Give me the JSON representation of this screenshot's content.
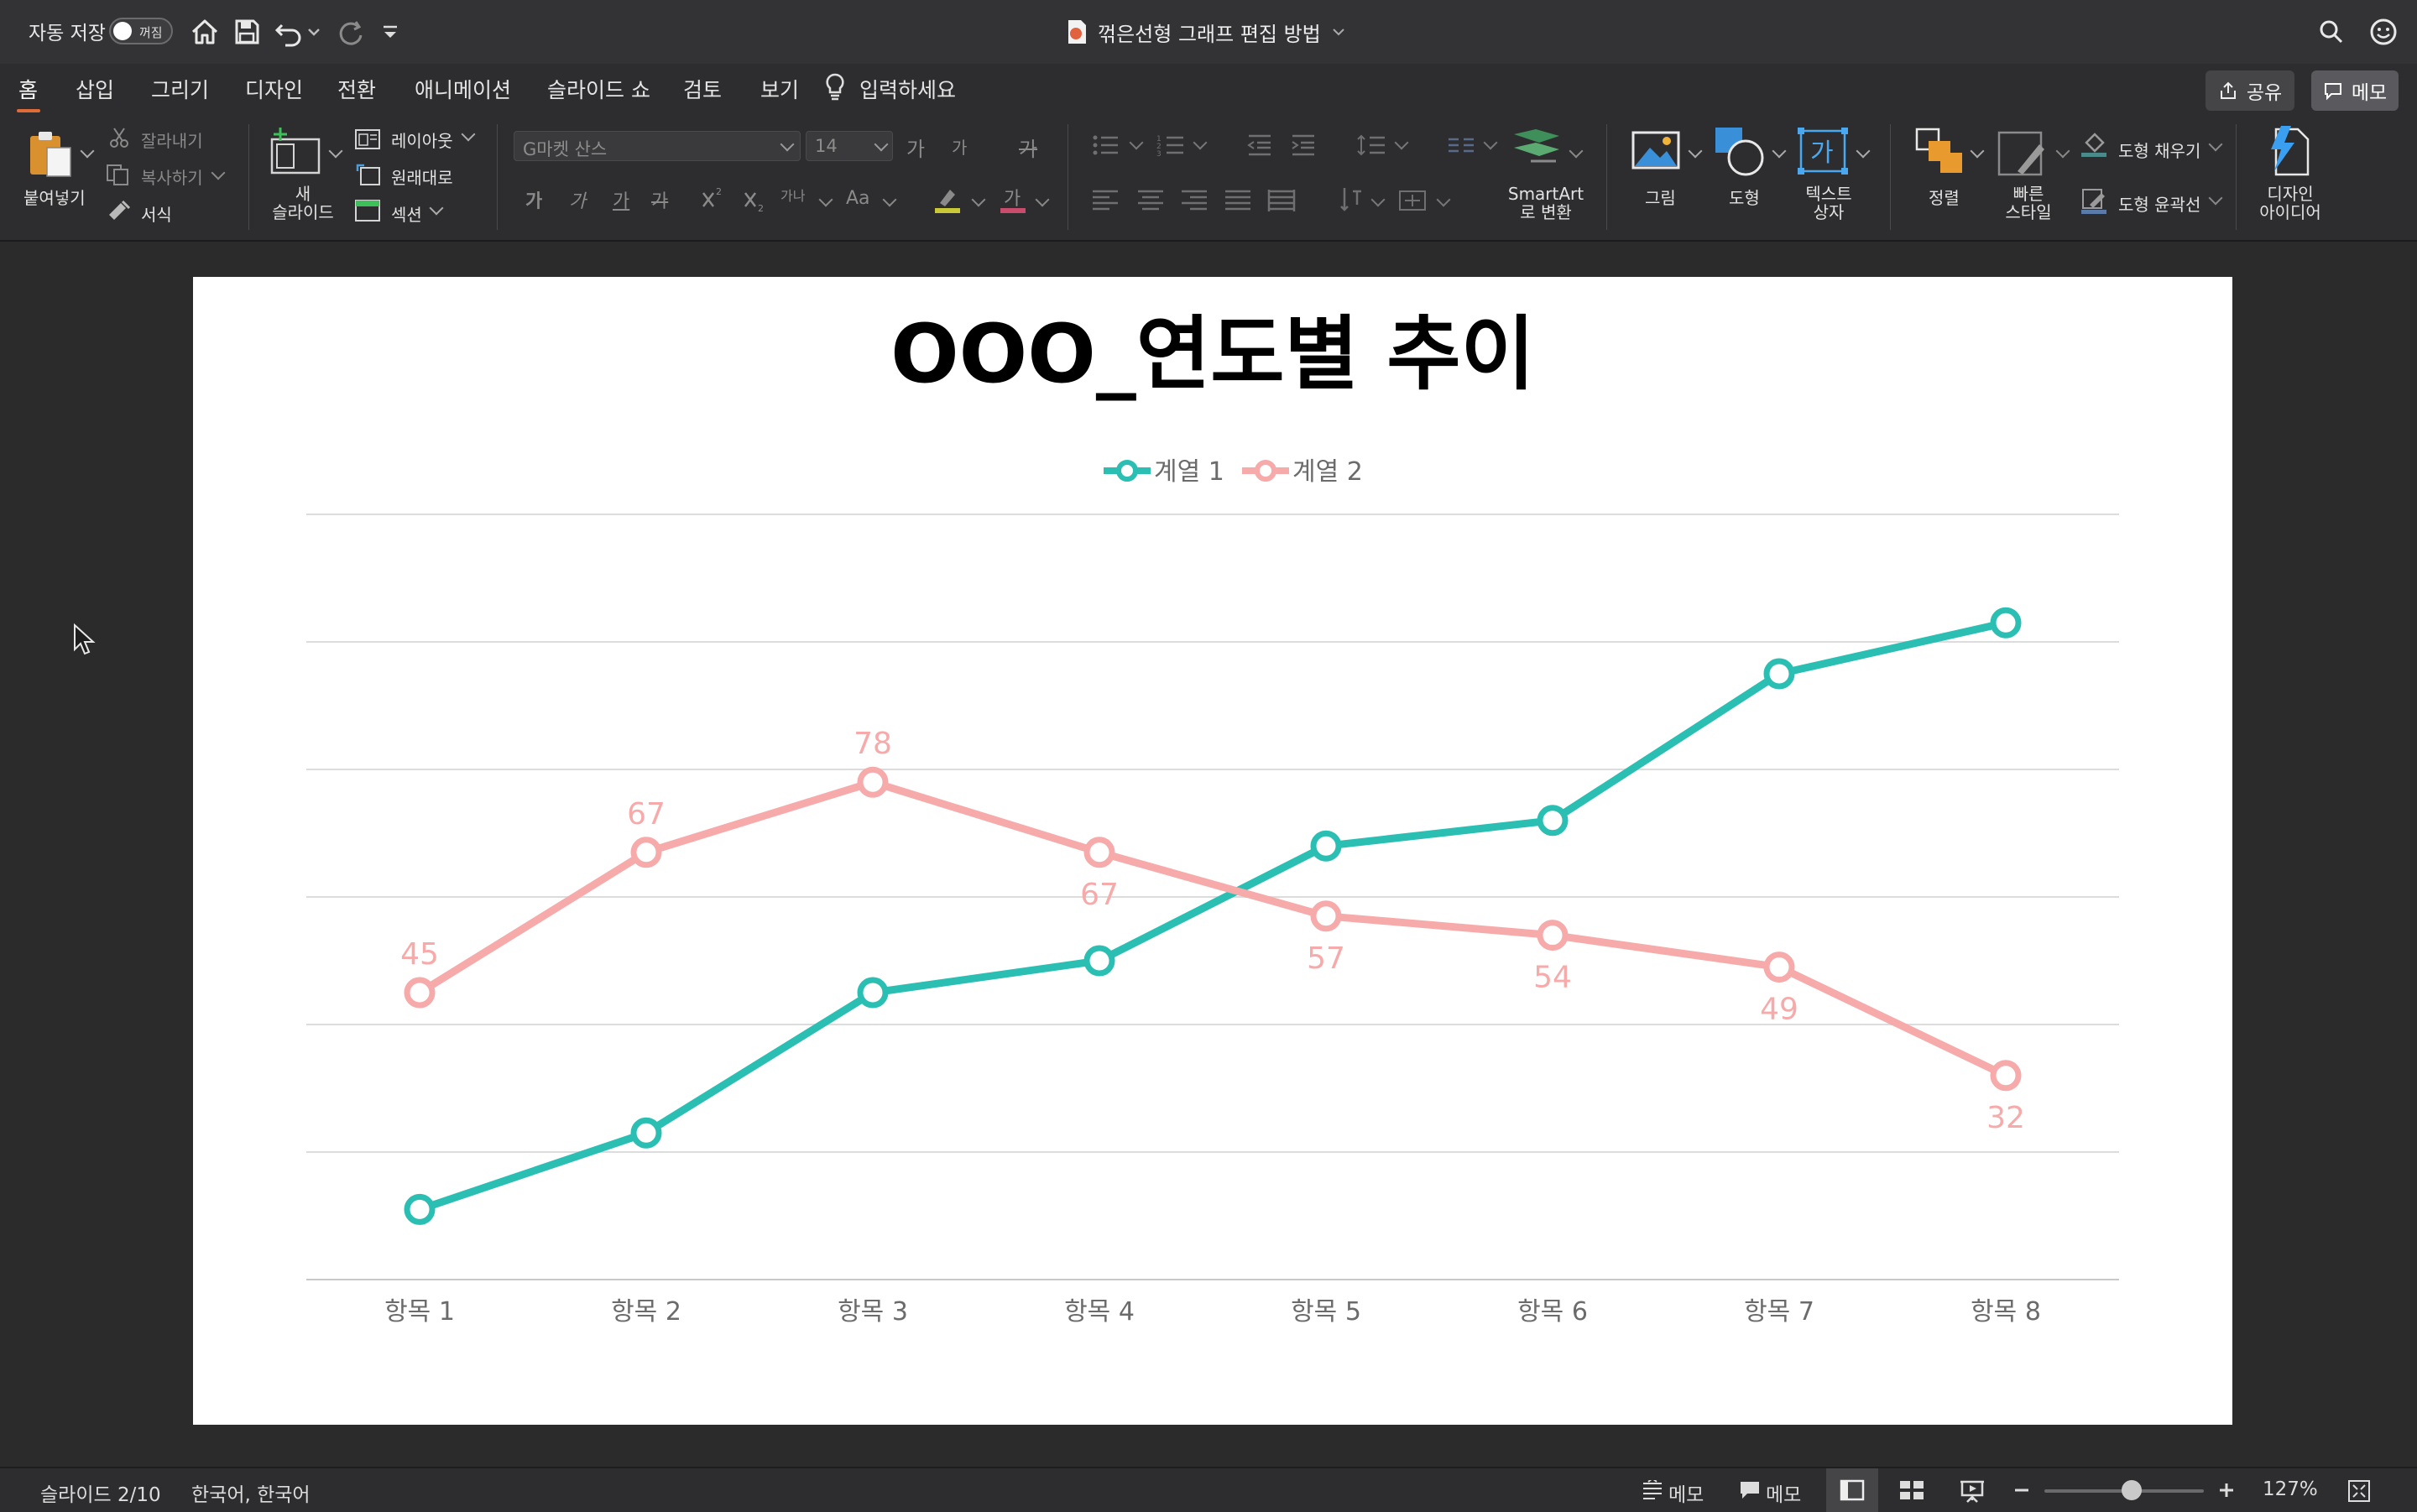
{
  "titlebar": {
    "autosave_label": "자동 저장",
    "autosave_state": "꺼짐",
    "document_title": "꺾은선형 그래프 편집 방법"
  },
  "menu": {
    "tabs": [
      "홈",
      "삽입",
      "그리기",
      "디자인",
      "전환",
      "애니메이션",
      "슬라이드 쇼",
      "검토",
      "보기"
    ],
    "tell_me": "입력하세요",
    "share": "공유",
    "memo": "메모"
  },
  "ribbon": {
    "paste": "붙여넣기",
    "cut": "잘라내기",
    "copy": "복사하기",
    "format_painter": "서식",
    "new_slide_line1": "새",
    "new_slide_line2": "슬라이드",
    "layout": "레이아웃",
    "reset": "원래대로",
    "section": "섹션",
    "font_name": "G마켓 산스",
    "font_size": "14",
    "font_grow": "가",
    "font_shrink": "가",
    "clear_format": "가",
    "bold": "가",
    "italic": "가",
    "underline": "가",
    "strike": "가",
    "spacing": "가나",
    "case": "Aa",
    "font_color": "가",
    "smartart_line1": "SmartArt",
    "smartart_line2": "로 변환",
    "picture": "그림",
    "shape": "도형",
    "textbox_line1": "텍스트",
    "textbox_line2": "상자",
    "textbox_glyph": "가",
    "arrange": "정렬",
    "quick_style_line1": "빠른",
    "quick_style_line2": "스타일",
    "shape_fill": "도형 채우기",
    "shape_outline": "도형 윤곽선",
    "designer_line1": "디자인",
    "designer_line2": "아이디어"
  },
  "status": {
    "slide_info": "슬라이드 2/10",
    "language": "한국어, 한국어",
    "notes": "메모",
    "comments": "메모",
    "zoom": "127%"
  },
  "colors": {
    "series1": "#2bbfb3",
    "series2": "#f7aaaa",
    "accent": "#e06a38"
  },
  "chart_data": {
    "type": "line",
    "title": "OOO_연도별 추이",
    "categories": [
      "항목 1",
      "항목 2",
      "항목 3",
      "항목 4",
      "항목 5",
      "항목 6",
      "항목 7",
      "항목 8"
    ],
    "series": [
      {
        "name": "계열 1",
        "values": [
          11,
          23,
          45,
          50,
          68,
          72,
          95,
          103
        ],
        "data_labels": false
      },
      {
        "name": "계열 2",
        "values": [
          45,
          67,
          78,
          67,
          57,
          54,
          49,
          32
        ],
        "data_labels": true
      }
    ],
    "ylim": [
      0,
      120
    ],
    "grid": true,
    "legend": "top",
    "xlabel": "",
    "ylabel": ""
  }
}
